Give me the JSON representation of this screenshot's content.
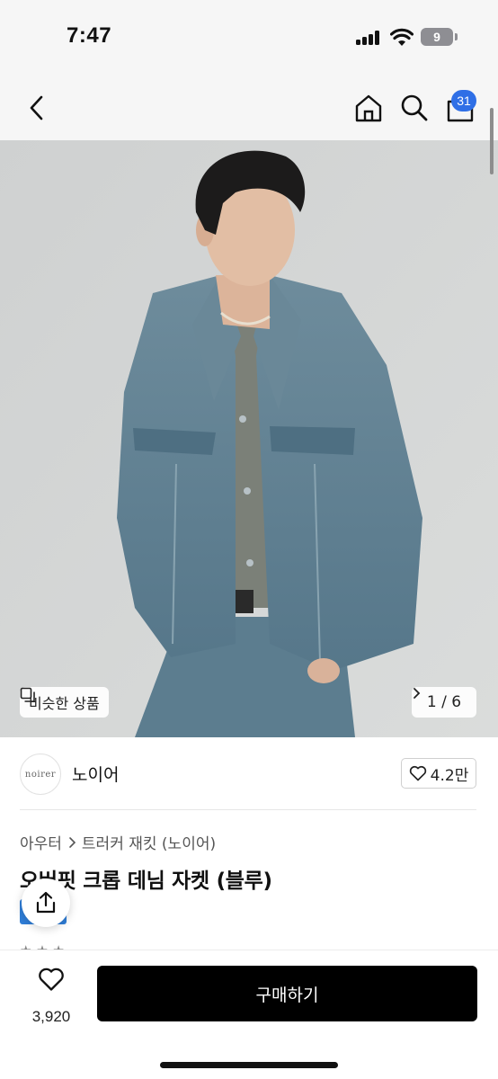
{
  "status_bar": {
    "time": "7:47",
    "battery": "9"
  },
  "nav": {
    "cart_count": "31",
    "icons": [
      "chevron-left-icon",
      "home-icon",
      "search-icon",
      "shopping-bag-icon"
    ]
  },
  "hero": {
    "similar_label": "비슷한 상품",
    "page_indicator": "1 / 6",
    "colors": {
      "background": "#d4d6d6",
      "denim": "#5f7f92"
    }
  },
  "brand": {
    "logo_text": "noirer",
    "name": "노이어",
    "like_count": "4.2만"
  },
  "breadcrumb": {
    "category": "아우터",
    "subcategory": "트러커 재킷 (노이어)"
  },
  "product": {
    "title": "오버핏 크롭 데님 자켓 (블루)"
  },
  "bottom_bar": {
    "wish_count": "3,920",
    "buy_label": "구매하기"
  },
  "colors": {
    "accent": "#2f6fe6",
    "buy_button": "#000000"
  }
}
